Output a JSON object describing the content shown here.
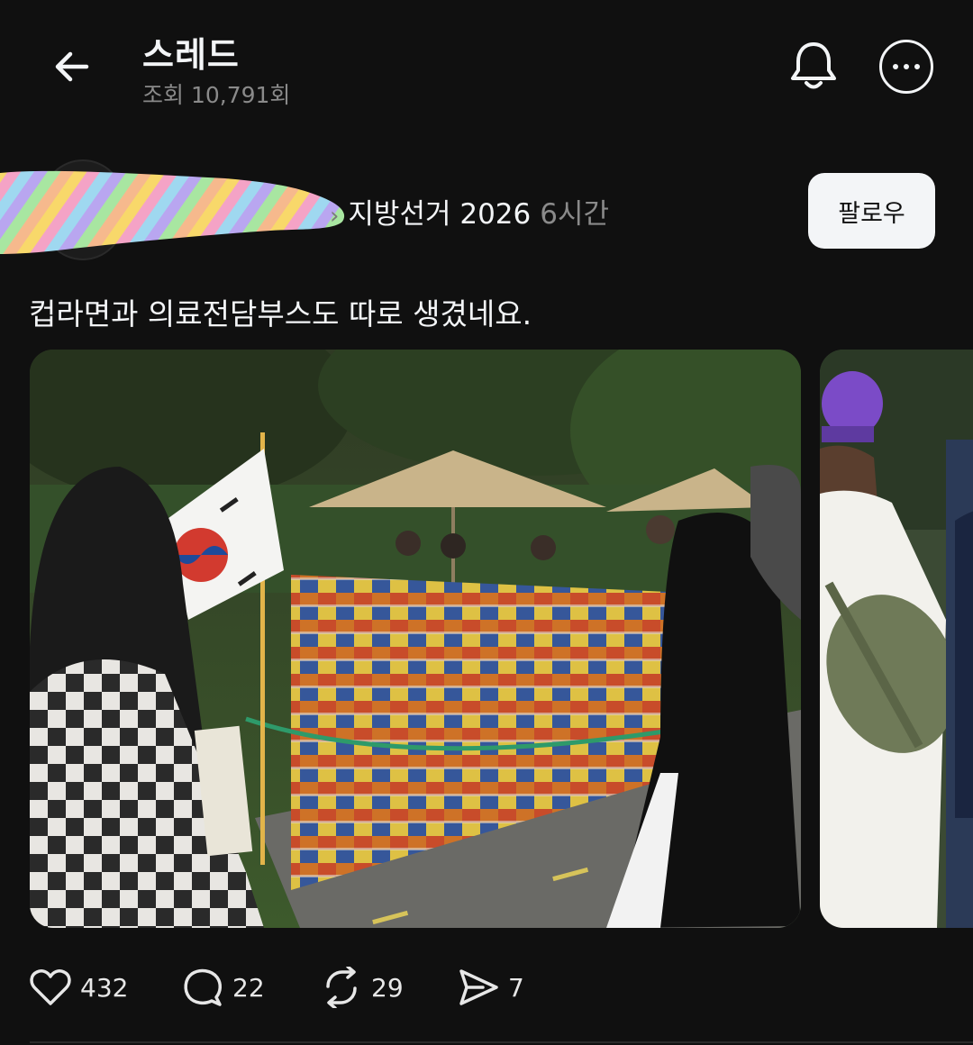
{
  "header": {
    "title": "스레드",
    "views": "조회 10,791회"
  },
  "post": {
    "topic": "지방선거 2026",
    "time": "6시간",
    "follow_label": "팔로우",
    "text": "컵라면과 의료전담부스도 따로 생겼네요.",
    "images": [
      "photo-1",
      "photo-2"
    ]
  },
  "actions": {
    "likes": "432",
    "replies": "22",
    "reposts": "29",
    "shares": "7"
  },
  "icons": {
    "back": "arrow-left-icon",
    "notifications": "bell-icon",
    "more": "ellipsis-circle-icon",
    "like": "heart-icon",
    "reply": "speech-bubble-icon",
    "repost": "repost-icon",
    "share": "paper-plane-icon"
  },
  "colors": {
    "background": "#101010",
    "text": "#f3f5f7",
    "muted": "#8a8a8a"
  }
}
